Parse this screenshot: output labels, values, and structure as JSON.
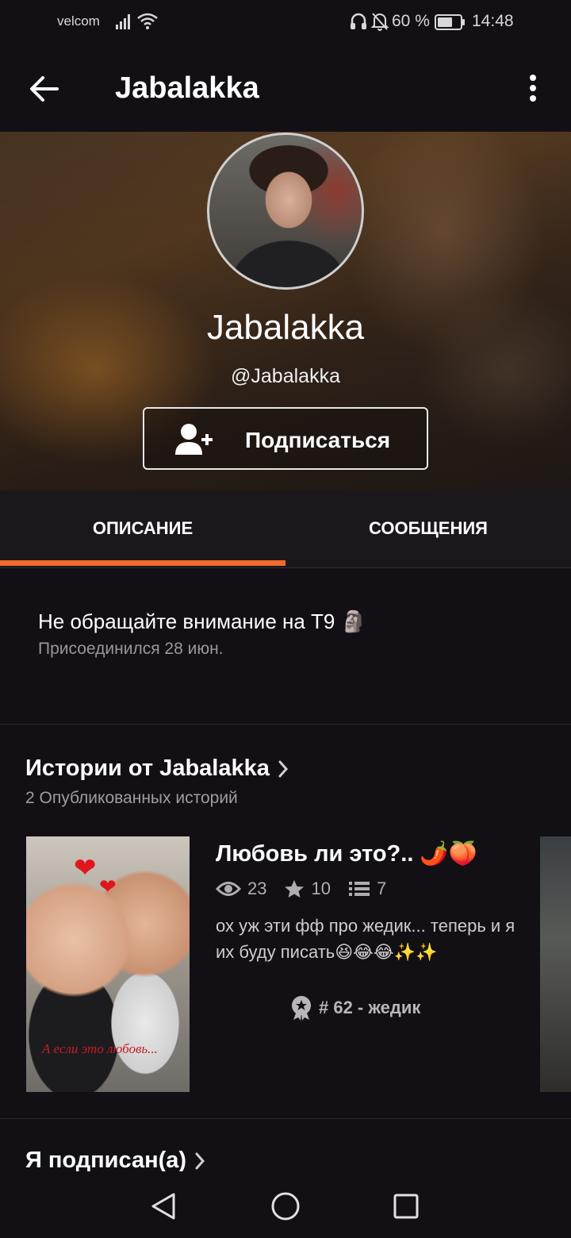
{
  "status_bar": {
    "carrier": "velcom",
    "battery_percent": "60 %",
    "time": "14:48",
    "icons": [
      "signal-icon",
      "wifi-icon",
      "headphones-icon",
      "bell-muted-icon",
      "battery-icon"
    ]
  },
  "app_bar": {
    "title": "Jabalakka",
    "back_icon": "arrow-left-icon",
    "more_icon": "more-vertical-icon"
  },
  "profile": {
    "display_name": "Jabalakka",
    "handle": "@Jabalakka",
    "follow_label": "Подписаться",
    "follow_icon": "add-user-icon"
  },
  "tabs": [
    {
      "label": "ОПИСАНИЕ",
      "active": true
    },
    {
      "label": "СООБЩЕНИЯ",
      "active": false
    }
  ],
  "about": {
    "bio": "Не обращайте внимание на Т9 🗿",
    "joined": "Присоединился 28 июн."
  },
  "stories": {
    "title": "Истории от Jabalakka",
    "count_text": "2 Опубликованных историй",
    "items": [
      {
        "title": "Любовь ли это?.. 🌶️🍑",
        "views": "23",
        "votes": "10",
        "parts": "7",
        "description": "ох уж эти фф про жедик... теперь и я их буду писать😆😂😂✨✨",
        "rank": "# 62 - жедик",
        "cover_caption": "А если это любовь..."
      }
    ]
  },
  "following": {
    "title": "Я подписан(а)"
  },
  "colors": {
    "accent": "#f26a2c",
    "background": "#121015",
    "tab_background": "#1b181b"
  }
}
